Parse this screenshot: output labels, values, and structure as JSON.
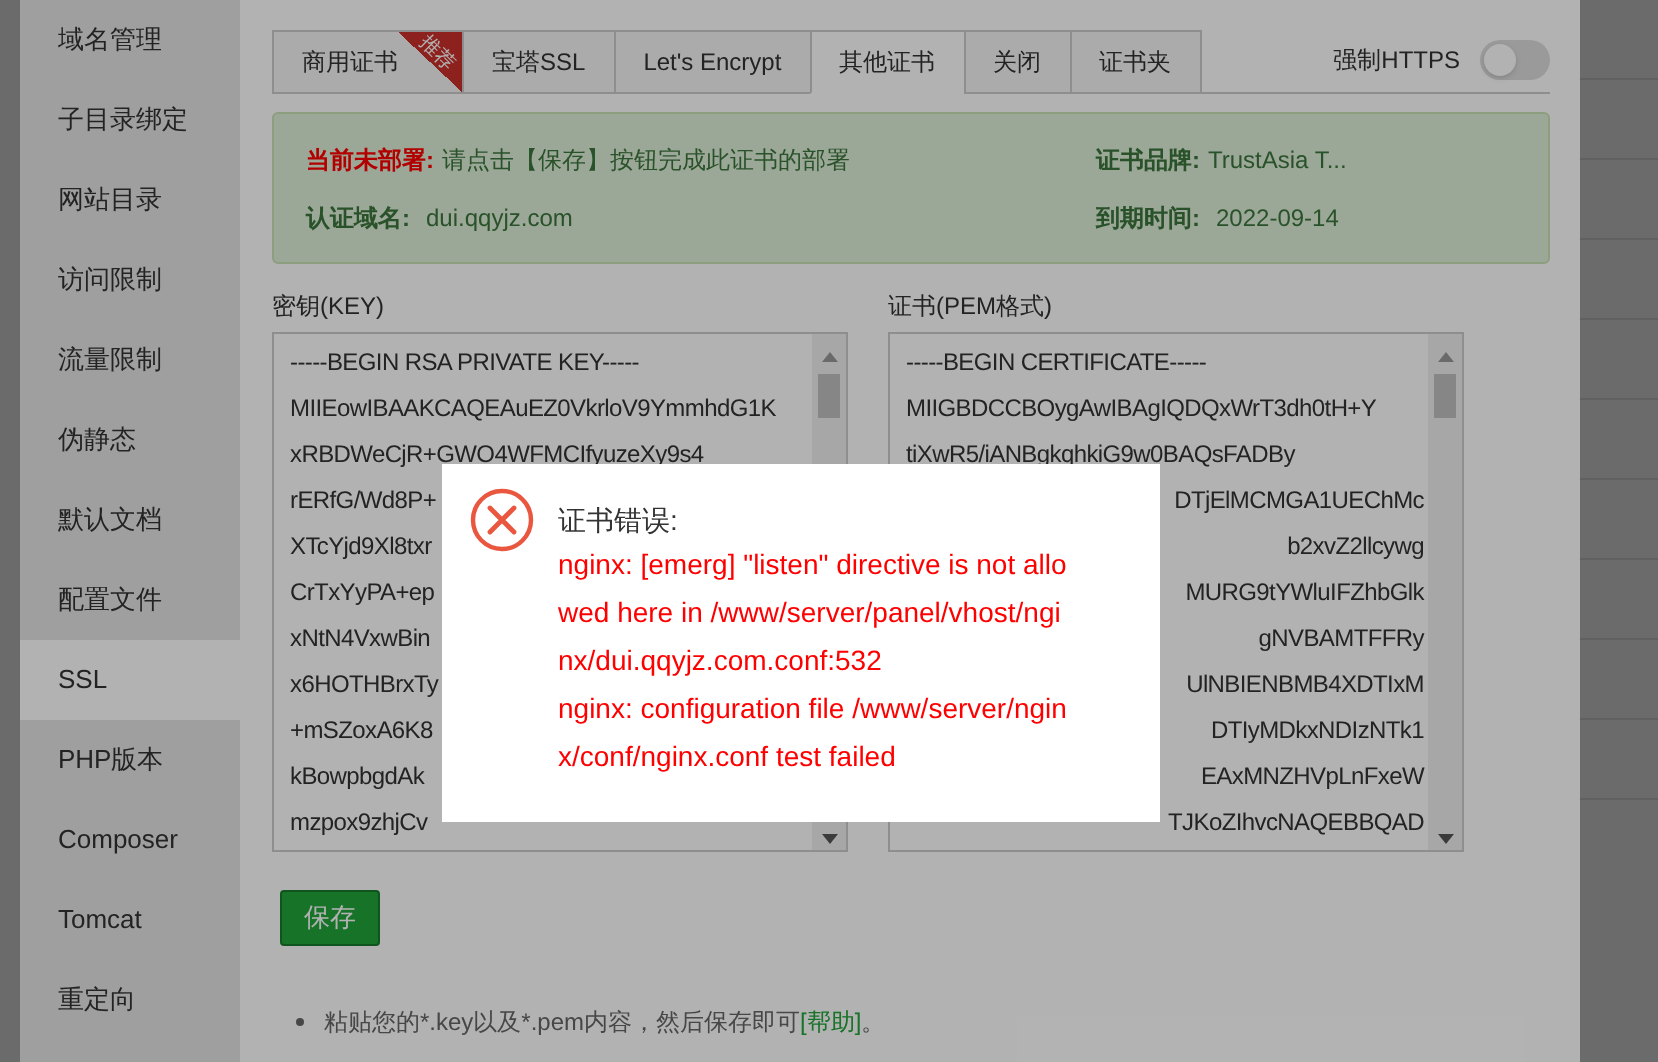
{
  "sidebar": {
    "items": [
      {
        "label": "域名管理",
        "selected": false
      },
      {
        "label": "子目录绑定",
        "selected": false
      },
      {
        "label": "网站目录",
        "selected": false
      },
      {
        "label": "访问限制",
        "selected": false
      },
      {
        "label": "流量限制",
        "selected": false
      },
      {
        "label": "伪静态",
        "selected": false
      },
      {
        "label": "默认文档",
        "selected": false
      },
      {
        "label": "配置文件",
        "selected": false
      },
      {
        "label": "SSL",
        "selected": true
      },
      {
        "label": "PHP版本",
        "selected": false
      },
      {
        "label": "Composer",
        "selected": false
      },
      {
        "label": "Tomcat",
        "selected": false
      },
      {
        "label": "重定向",
        "selected": false
      }
    ]
  },
  "tabs": [
    {
      "label": "商用证书",
      "selected": false,
      "badge": "推荐"
    },
    {
      "label": "宝塔SSL",
      "selected": false
    },
    {
      "label": "Let's Encrypt",
      "selected": false
    },
    {
      "label": "其他证书",
      "selected": true
    },
    {
      "label": "关闭",
      "selected": false
    },
    {
      "label": "证书夹",
      "selected": false
    }
  ],
  "force_https": {
    "label": "强制HTTPS",
    "on": false
  },
  "status": {
    "warning_label": "当前未部署:",
    "warning_text": "请点击【保存】按钮完成此证书的部署",
    "brand_label": "证书品牌:",
    "brand": "TrustAsia T...",
    "domain_label": "认证域名:",
    "domain": "dui.qqyjz.com",
    "expiry_label": "到期时间:",
    "expiry": "2022-09-14"
  },
  "key_field": {
    "label": "密钥(KEY)",
    "lines": [
      "-----BEGIN RSA PRIVATE KEY-----",
      "MIIEowIBAAKCAQEAuEZ0VkrloV9YmmhdG1K",
      "xRBDWeCjR+GWO4WFMCIfyuzeXy9s4",
      "rERfG/Wd8P+",
      "XTcYjd9Xl8txr",
      "CrTxYyPA+ep",
      "xNtN4VxwBin",
      "x6HOTHBrxTy",
      "+mSZoxA6K8",
      "kBowpbgdAk",
      "mzpox9zhjCv"
    ]
  },
  "cert_field": {
    "label": "证书(PEM格式)",
    "lines": [
      {
        "text": "-----BEGIN CERTIFICATE-----",
        "kind": "full"
      },
      {
        "text": "MIIGBDCCBOygAwIBAgIQDQxWrT3dh0tH+Y",
        "kind": "full"
      },
      {
        "text": "tiXwR5/iANBgkqhkiG9w0BAQsFADBy",
        "kind": "full"
      },
      {
        "text": "DTjElMCMGA1UEChMc",
        "kind": "tail"
      },
      {
        "text": "b2xvZ2llcywg",
        "kind": "tail"
      },
      {
        "text": "MURG9tYWluIFZhbGlk",
        "kind": "tail"
      },
      {
        "text": "gNVBAMTFFRy",
        "kind": "tail"
      },
      {
        "text": "UlNBIENBMB4XDTIxM",
        "kind": "tail"
      },
      {
        "text": "DTIyMDkxNDIzNTk1",
        "kind": "tail"
      },
      {
        "text": "EAxMNZHVpLnFxeW",
        "kind": "tail"
      },
      {
        "text": "TJKoZIhvcNAQEBBQAD",
        "kind": "tail"
      }
    ]
  },
  "save_button": "保存",
  "tips": [
    {
      "text": "粘贴您的*.key以及*.pem内容，然后保存即可",
      "link": "[帮助]",
      "end": "。"
    }
  ],
  "dialog": {
    "title": "证书错误:",
    "lines": [
      "nginx: [emerg] \"listen\" directive is not allo",
      "wed here in /www/server/panel/vhost/ngi",
      "nx/dui.qqyjz.com.conf:532",
      "nginx: configuration file /www/server/ngin",
      "x/conf/nginx.conf test failed"
    ]
  }
}
